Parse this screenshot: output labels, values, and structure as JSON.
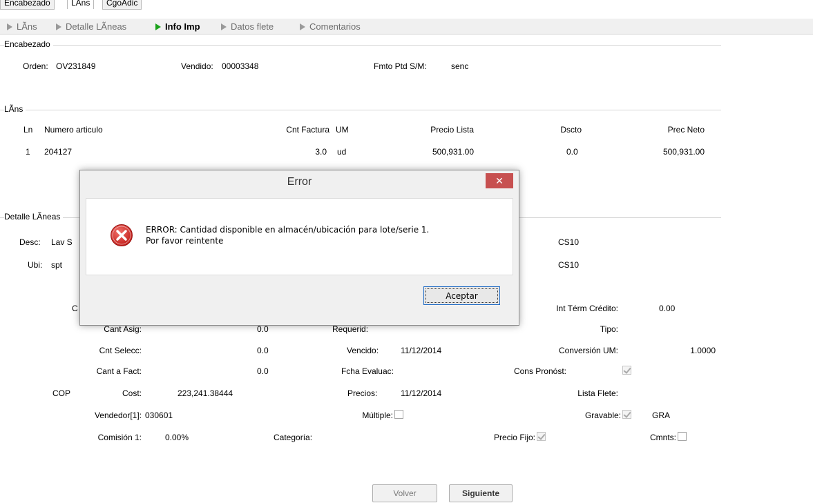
{
  "tabs": [
    "Encabezado",
    "LÃns",
    "CgoAdic"
  ],
  "steps": [
    "LÃns",
    "Detalle LÃneas",
    "Info Imp",
    "Datos flete",
    "Comentarios"
  ],
  "header_group": {
    "title": "Encabezado",
    "orden_label": "Orden:",
    "orden_value": "OV231849",
    "vendido_label": "Vendido:",
    "vendido_value": "00003348",
    "fmto_label": "Fmto Ptd S/M:",
    "fmto_value": "senc"
  },
  "lines_group": {
    "title": "LÃns",
    "columns": [
      "Ln",
      "Numero articulo",
      "Cnt Factura",
      "UM",
      "Precio Lista",
      "Dscto",
      "Prec Neto"
    ],
    "rows": [
      [
        "1",
        "204127",
        "3.0",
        "ud",
        "500,931.00",
        "0.0",
        "500,931.00"
      ]
    ]
  },
  "detail_group": {
    "title": "Detalle LÃneas",
    "desc_label": "Desc:",
    "desc_value": "Lav S",
    "ubi_label": "Ubi:",
    "ubi_value": "spt",
    "cs10_a": "CS10",
    "cs10_b": "CS10",
    "c_partial": "C",
    "int_term_label": "Int Térm Crédito:",
    "int_term_value": "0.00",
    "cant_asig_label": "Cant Asig:",
    "cant_asig_value": "0.0",
    "requerid_label": "Requerid:",
    "tipo_label": "Tipo:",
    "cnt_selecc_label": "Cnt Selecc:",
    "cnt_selecc_value": "0.0",
    "vencido_label": "Vencido:",
    "vencido_value": "11/12/2014",
    "conversion_label": "Conversión UM:",
    "conversion_value": "1.0000",
    "cant_fact_label": "Cant a Fact:",
    "cant_fact_value": "0.0",
    "fcha_eval_label": "Fcha Evaluac:",
    "cons_pron_label": "Cons Pronóst:",
    "currency": "COP",
    "cost_label": "Cost:",
    "cost_value": "223,241.38444",
    "precios_label": "Precios:",
    "precios_value": "11/12/2014",
    "lista_flete_label": "Lista Flete:",
    "vendedor_label": "Vendedor[1]:",
    "vendedor_value": "030601",
    "multiple_label": "Múltiple:",
    "gravable_label": "Gravable:",
    "gravable_value": "GRA",
    "comision_label": "Comisión 1:",
    "comision_value": "0.00%",
    "categoria_label": "Categoría:",
    "precio_fijo_label": "Precio Fijo:",
    "cmnts_label": "Cmnts:"
  },
  "footer": {
    "volver": "Volver",
    "siguiente": "Siguiente"
  },
  "dialog": {
    "title": "Error",
    "close": "✕",
    "message_line1": "ERROR: Cantidad disponible en almacén/ubicación para lote/serie 1.",
    "message_line2": "Por favor reintente",
    "ok": "Aceptar"
  },
  "colors": {
    "accent_green": "#1aa11a",
    "error_red": "#d9302c",
    "close_red": "#c75050"
  },
  "icons": {
    "step": "play-triangle-icon",
    "dialog": "error-circle-x-icon"
  }
}
